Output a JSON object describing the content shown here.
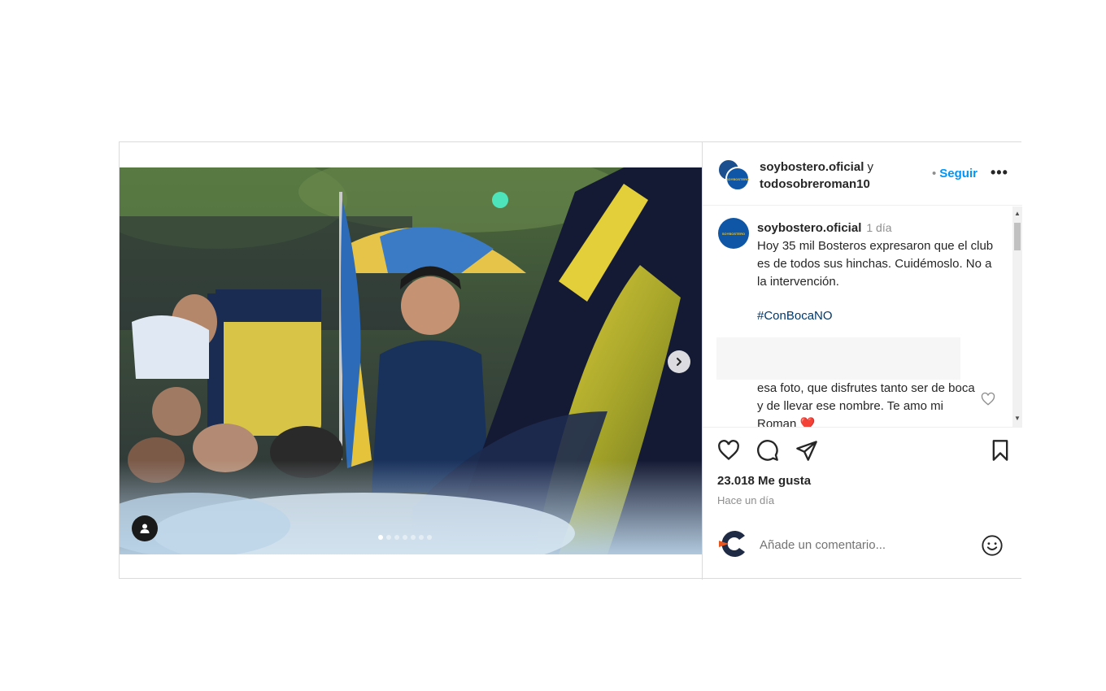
{
  "post": {
    "header": {
      "author1": "soybostero.oficial",
      "joiner": " y",
      "author2": "todosobreroman10",
      "follow_label": "Seguir",
      "follow_bullet": "•",
      "avatar_text": "SOYBOSTERO"
    },
    "caption": {
      "username": "soybostero.oficial",
      "time": "1 día",
      "text": "Hoy 35 mil Bosteros expresaron que el club es de todos sus hinchas. Cuidémoslo. No a la intervención.",
      "hashtag": "#ConBocaNO"
    },
    "reply": {
      "text": "esa foto, que disfrutes tanto ser de boca y de llevar ese nombre. Te amo mi Roman ❤️"
    },
    "likes": "23.018 Me gusta",
    "time_ago": "Hace un día",
    "comment_placeholder": "Añade un comentario...",
    "carousel": {
      "total": 7,
      "active": 1
    },
    "colors": {
      "link": "#0095f6",
      "hashtag": "#00376b",
      "boca_blue": "#0f57a6",
      "boca_yellow": "#f6c21a"
    },
    "icons": [
      "heart-icon",
      "comment-icon",
      "share-icon",
      "bookmark-icon",
      "emoji-icon",
      "chevron-right-icon",
      "user-tag-icon",
      "more-icon"
    ]
  }
}
